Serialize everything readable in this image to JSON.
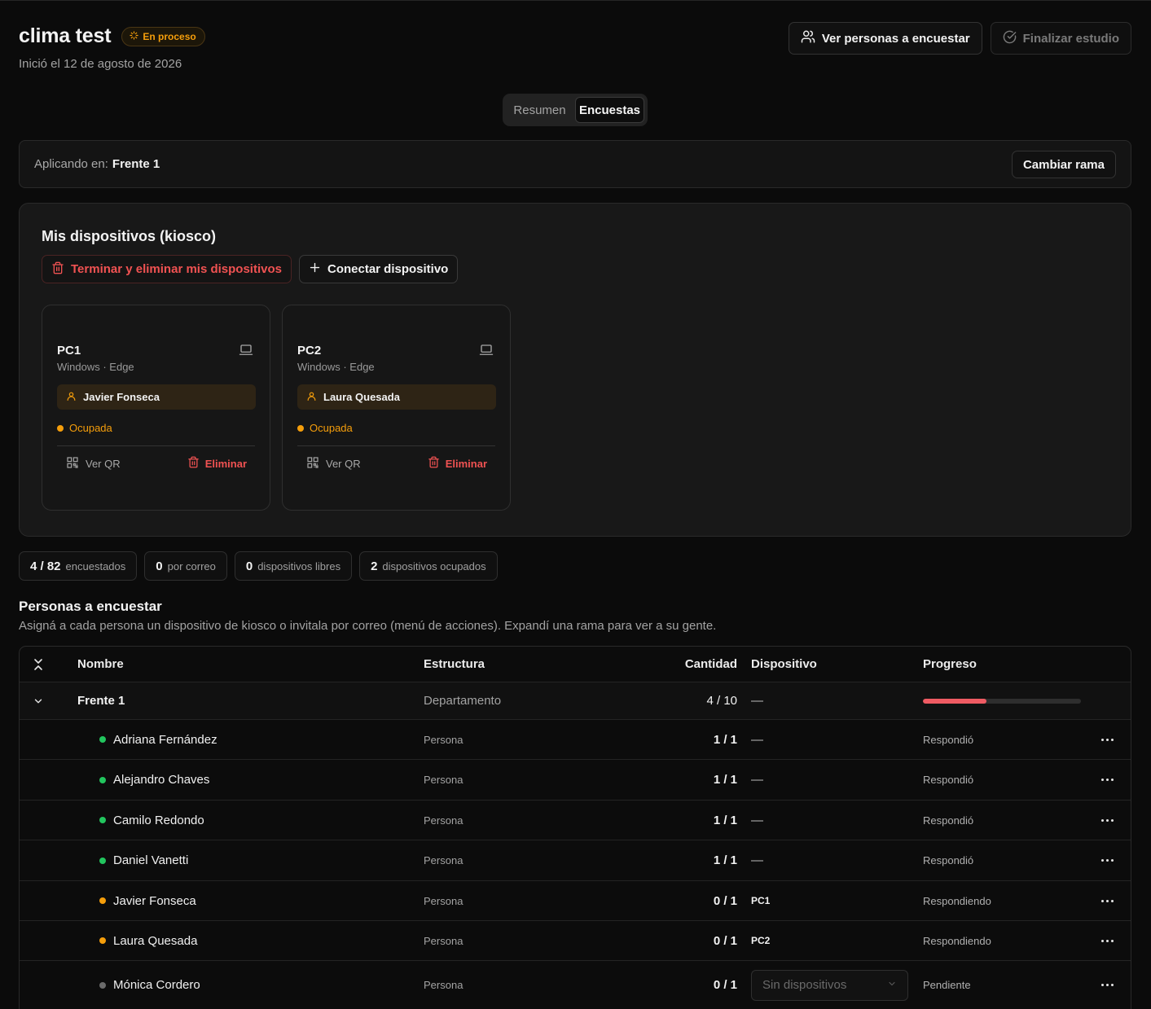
{
  "study": {
    "title": "clima test",
    "status_badge": "En proceso",
    "started": "Inició el 12 de agosto de 2026",
    "view_people_label": "Ver personas a encuestar",
    "finish_label": "Finalizar estudio"
  },
  "tabs": [
    {
      "label": "Resumen",
      "active": false
    },
    {
      "label": "Encuestas",
      "active": true
    }
  ],
  "branch": {
    "label": "Aplicando en:",
    "value": "Frente 1",
    "change_label": "Cambiar rama"
  },
  "devices": {
    "title": "Mis dispositivos (kiosco)",
    "terminate_label": "Terminar y eliminar mis dispositivos",
    "connect_label": "Conectar dispositivo",
    "items": [
      {
        "name": "PC1",
        "os": "Windows · Edge",
        "user": "Javier Fonseca",
        "status": "Ocupada",
        "qr_label": "Ver QR",
        "delete_label": "Eliminar"
      },
      {
        "name": "PC2",
        "os": "Windows · Edge",
        "user": "Laura Quesada",
        "status": "Ocupada",
        "qr_label": "Ver QR",
        "delete_label": "Eliminar"
      }
    ]
  },
  "stats": [
    {
      "value": "4 / 82",
      "label": "encuestados"
    },
    {
      "value": "0",
      "label": "por correo"
    },
    {
      "value": "0",
      "label": "dispositivos libres"
    },
    {
      "value": "2",
      "label": "dispositivos ocupados"
    }
  ],
  "people": {
    "title": "Personas a encuestar",
    "description": "Asigná a cada persona un dispositivo de kiosco o invitala por correo (menú de acciones). Expandí una rama para ver a su gente.",
    "columns": {
      "name": "Nombre",
      "structure": "Estructura",
      "quantity": "Cantidad",
      "device": "Dispositivo",
      "progress": "Progreso"
    },
    "group": {
      "name": "Frente 1",
      "structure": "Departamento",
      "quantity": "4 / 10",
      "device": "—",
      "progress_fraction": 0.4
    },
    "rows": [
      {
        "name": "Adriana Fernández",
        "structure": "Persona",
        "quantity": "1 / 1",
        "device": "—",
        "progress": "Respondió"
      },
      {
        "name": "Alejandro Chaves",
        "structure": "Persona",
        "quantity": "1 / 1",
        "device": "—",
        "progress": "Respondió"
      },
      {
        "name": "Camilo Redondo",
        "structure": "Persona",
        "quantity": "1 / 1",
        "device": "—",
        "progress": "Respondió"
      },
      {
        "name": "Daniel Vanetti",
        "structure": "Persona",
        "quantity": "1 / 1",
        "device": "—",
        "progress": "Respondió"
      },
      {
        "name": "Javier Fonseca",
        "structure": "Persona",
        "quantity": "0 / 1",
        "device": "PC1",
        "progress": "Respondiendo"
      },
      {
        "name": "Laura Quesada",
        "structure": "Persona",
        "quantity": "0 / 1",
        "device": "PC2",
        "progress": "Respondiendo"
      },
      {
        "name": "Mónica Cordero",
        "structure": "Persona",
        "quantity": "0 / 1",
        "device_select": "Sin dispositivos",
        "progress": "Pendiente"
      }
    ]
  },
  "colors": {
    "accent_orange": "#f59e0b",
    "danger_red": "#f05252",
    "done_green": "#22c55e",
    "pending_gray": "#6b6b6b",
    "progress_fill": "#ef5b63"
  }
}
